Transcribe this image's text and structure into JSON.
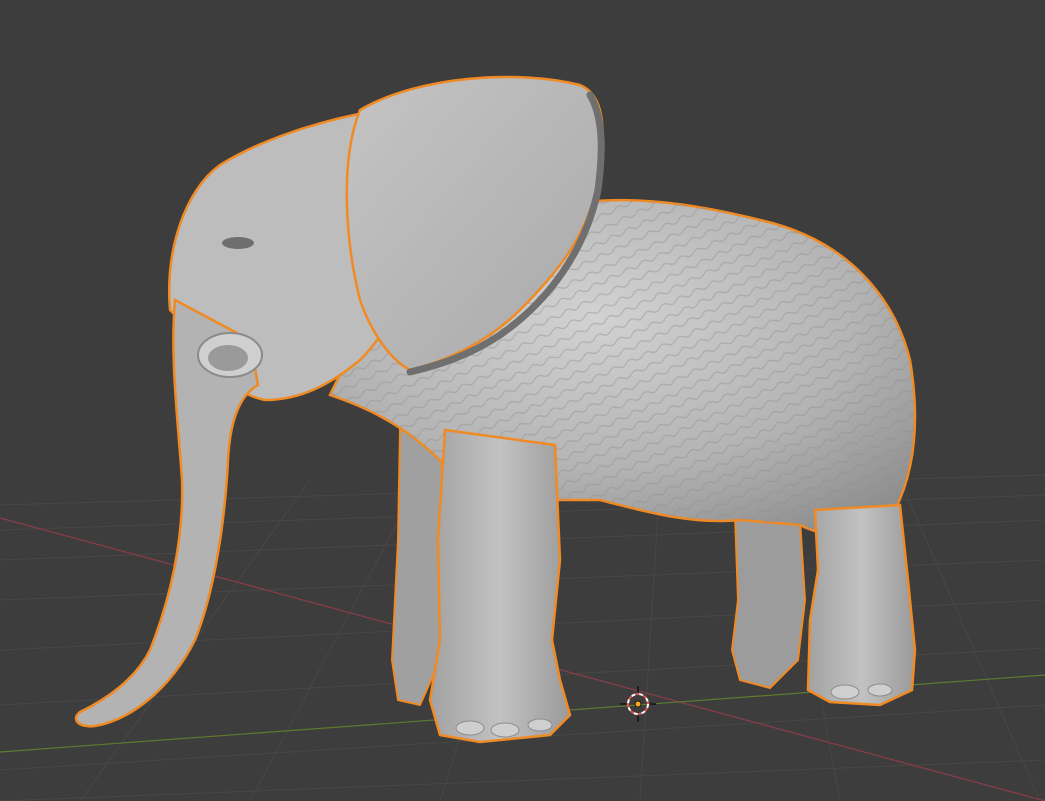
{
  "viewport": {
    "background_color": "#3d3d3d",
    "grid_line_color": "#474747",
    "x_axis_color": "#8a3d48",
    "y_axis_color": "#5e7a2e"
  },
  "object": {
    "name": "",
    "shape": "sculpted elephant mesh",
    "surface_color": "#b8b8b8",
    "selection_outline_color": "#f08a24",
    "selected": true
  },
  "cursor_3d": {
    "icon": "3d-cursor-icon",
    "ring_color_a": "#e05050",
    "ring_color_b": "#ffffff"
  },
  "origin_point": {
    "icon": "origin-dot-icon",
    "color": "#f5a623"
  }
}
